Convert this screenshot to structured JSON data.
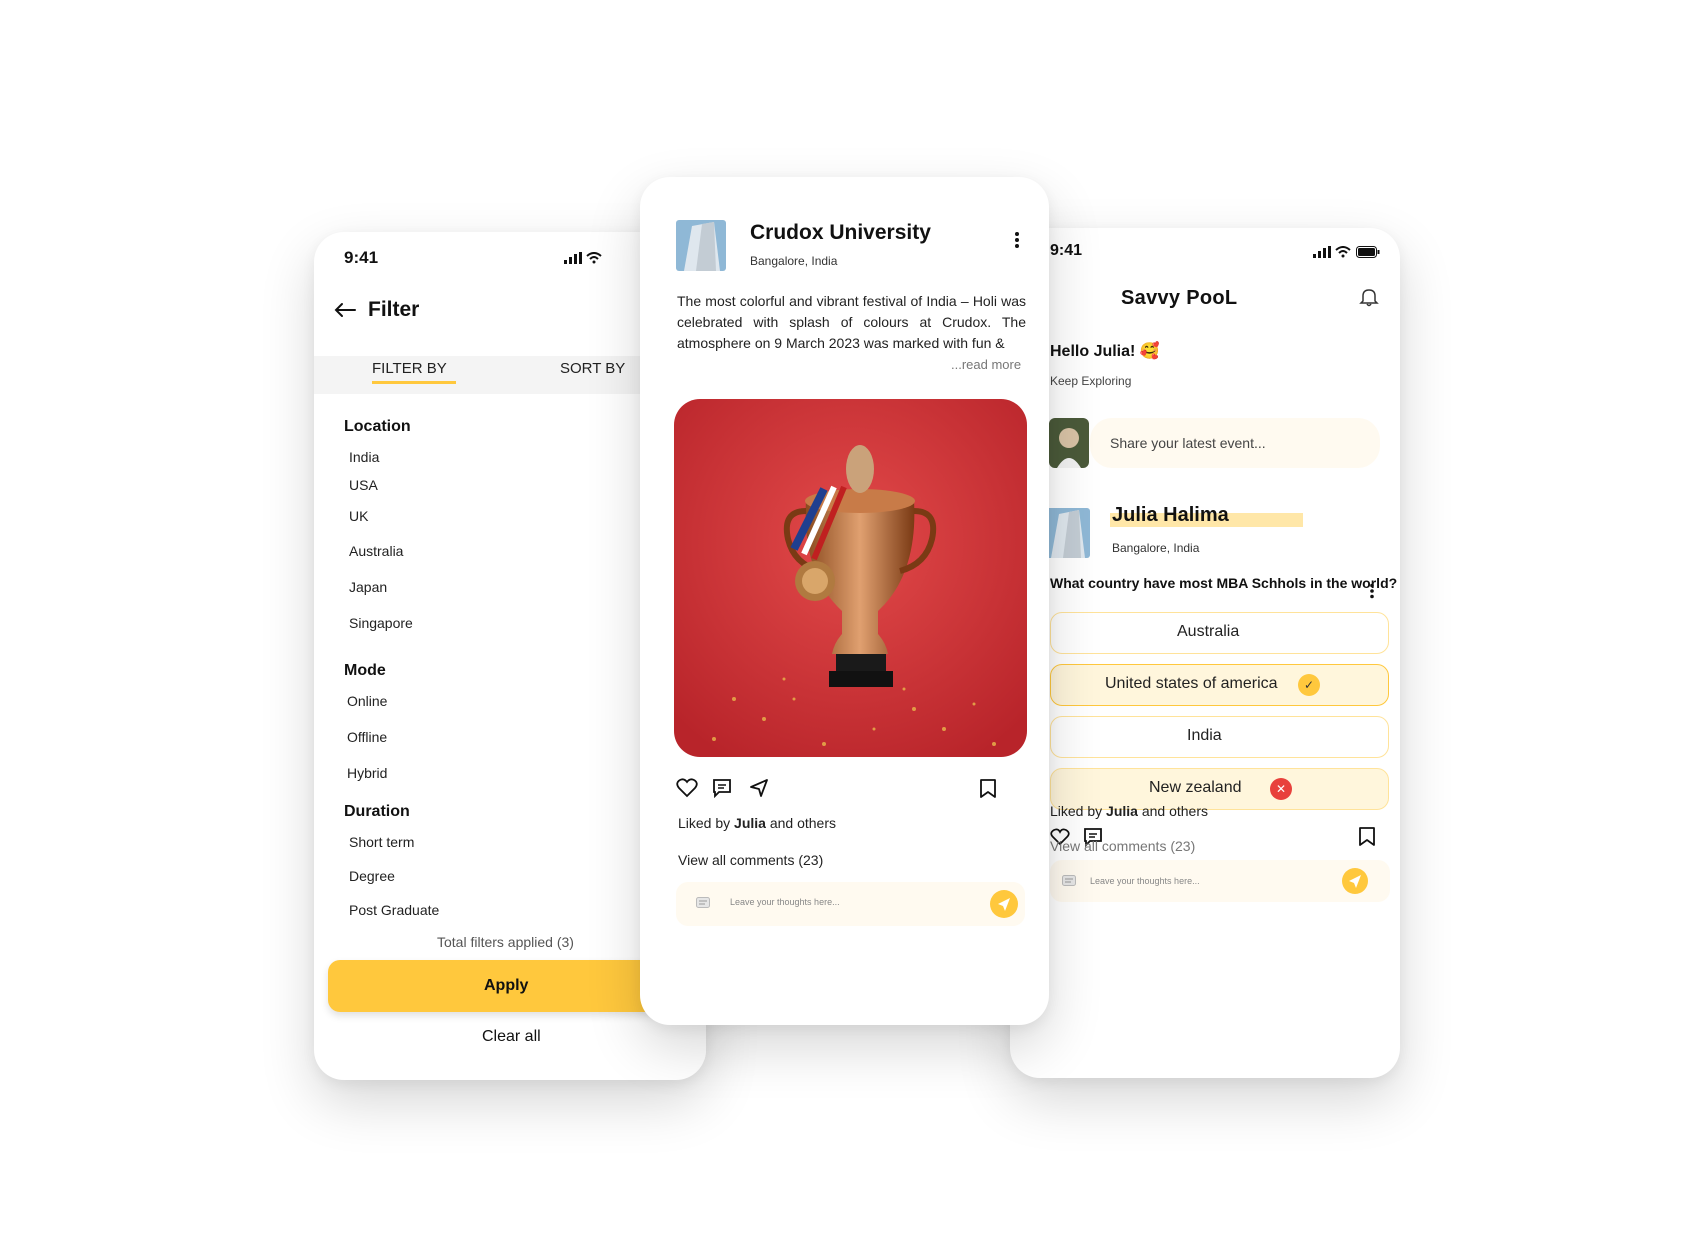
{
  "colors": {
    "accent": "#ffc83d",
    "accent_light": "#fff6dc",
    "error": "#e8413c",
    "card_bg": "#ffffff"
  },
  "filter_screen": {
    "status_time": "9:41",
    "title": "Filter",
    "tabs": [
      "FILTER BY",
      "SORT BY"
    ],
    "sections": [
      {
        "title": "Location",
        "options": [
          "India",
          "USA",
          "UK",
          "Australia",
          "Japan",
          "Singapore"
        ]
      },
      {
        "title": "Mode",
        "options": [
          "Online",
          "Offline",
          "Hybrid"
        ]
      },
      {
        "title": "Duration",
        "options": [
          "Short term",
          "Degree",
          "Post Graduate"
        ]
      }
    ],
    "total_filters": "Total filters applied (3)",
    "apply_label": "Apply",
    "clear_label": "Clear all"
  },
  "post_screen": {
    "author": "Crudox University",
    "location": "Bangalore, India",
    "text": "The most colorful and vibrant festival of India – Holi was celebrated with splash of colours at Crudox. The atmosphere on 9 March 2023 was marked with fun &",
    "read_more": "...read more",
    "liked_prefix": "Liked by ",
    "liked_name": "Julia",
    "liked_suffix": " and others",
    "view_comments": "View all comments (23)",
    "comment_placeholder": "Leave your thoughts here..."
  },
  "poll_screen": {
    "status_time": "9:41",
    "brand": "Savvy PooL",
    "greeting": "Hello Julia! 🥰",
    "subtitle": "Keep Exploring",
    "share_placeholder": "Share your latest event...",
    "author": "Julia Halima",
    "location": "Bangalore, India",
    "question": "What country have most MBA Schhols in the world?",
    "options": [
      {
        "label": "Australia",
        "state": "none"
      },
      {
        "label": "United states of america",
        "state": "correct"
      },
      {
        "label": "India",
        "state": "none"
      },
      {
        "label": "New zealand",
        "state": "wrong"
      }
    ],
    "liked_prefix": "Liked by ",
    "liked_name": "Julia",
    "liked_suffix": " and others",
    "view_comments": "View all comments (23)",
    "comment_placeholder": "Leave your thoughts here..."
  },
  "icons": [
    "back-arrow-icon",
    "signal-icon",
    "wifi-icon",
    "battery-icon",
    "more-vertical-icon",
    "heart-icon",
    "comment-icon",
    "send-icon",
    "bookmark-icon",
    "bell-icon",
    "chat-icon",
    "check-icon",
    "close-icon"
  ]
}
